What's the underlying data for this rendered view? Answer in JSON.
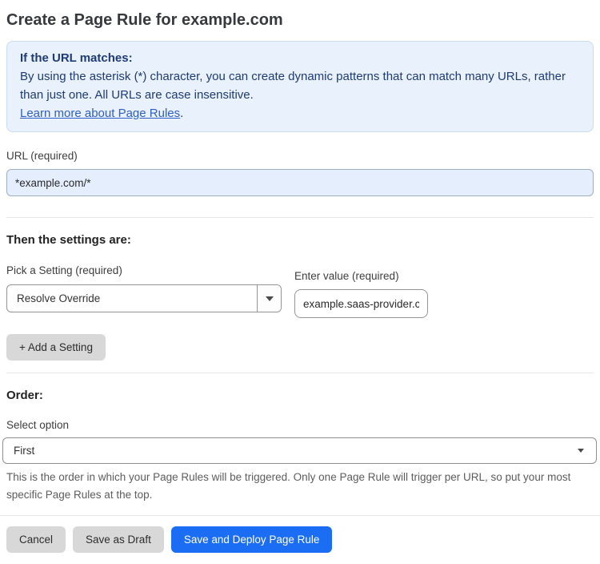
{
  "page": {
    "title": "Create a Page Rule for example.com"
  },
  "info_box": {
    "heading": "If the URL matches:",
    "body": "By using the asterisk (*) character, you can create dynamic patterns that can match many URLs, rather than just one. All URLs are case insensitive.",
    "link_label": "Learn more about Page Rules",
    "link_suffix": "."
  },
  "url_field": {
    "label": "URL (required)",
    "value": "*example.com/*"
  },
  "settings_section": {
    "heading": "Then the settings are:",
    "setting_select": {
      "label": "Pick a Setting (required)",
      "value": "Resolve Override"
    },
    "value_field": {
      "label": "Enter value (required)",
      "value": "example.saas-provider.c"
    },
    "add_setting_label": "+ Add a Setting"
  },
  "order_section": {
    "heading": "Order:",
    "select_label": "Select option",
    "select_value": "First",
    "helper_text": "This is the order in which your Page Rules will be triggered. Only one Page Rule will trigger per URL, so put your most specific Page Rules at the top."
  },
  "footer": {
    "cancel_label": "Cancel",
    "save_draft_label": "Save as Draft",
    "save_deploy_label": "Save and Deploy Page Rule"
  },
  "colors": {
    "accent_blue": "#1b6ef3",
    "info_bg": "#e9f1fc",
    "info_text": "#1e3b77",
    "link_blue": "#2e5ec9",
    "url_input_bg": "#e4eefc",
    "gray_button_bg": "#d8d8d8",
    "divider": "#e6e6e6"
  }
}
